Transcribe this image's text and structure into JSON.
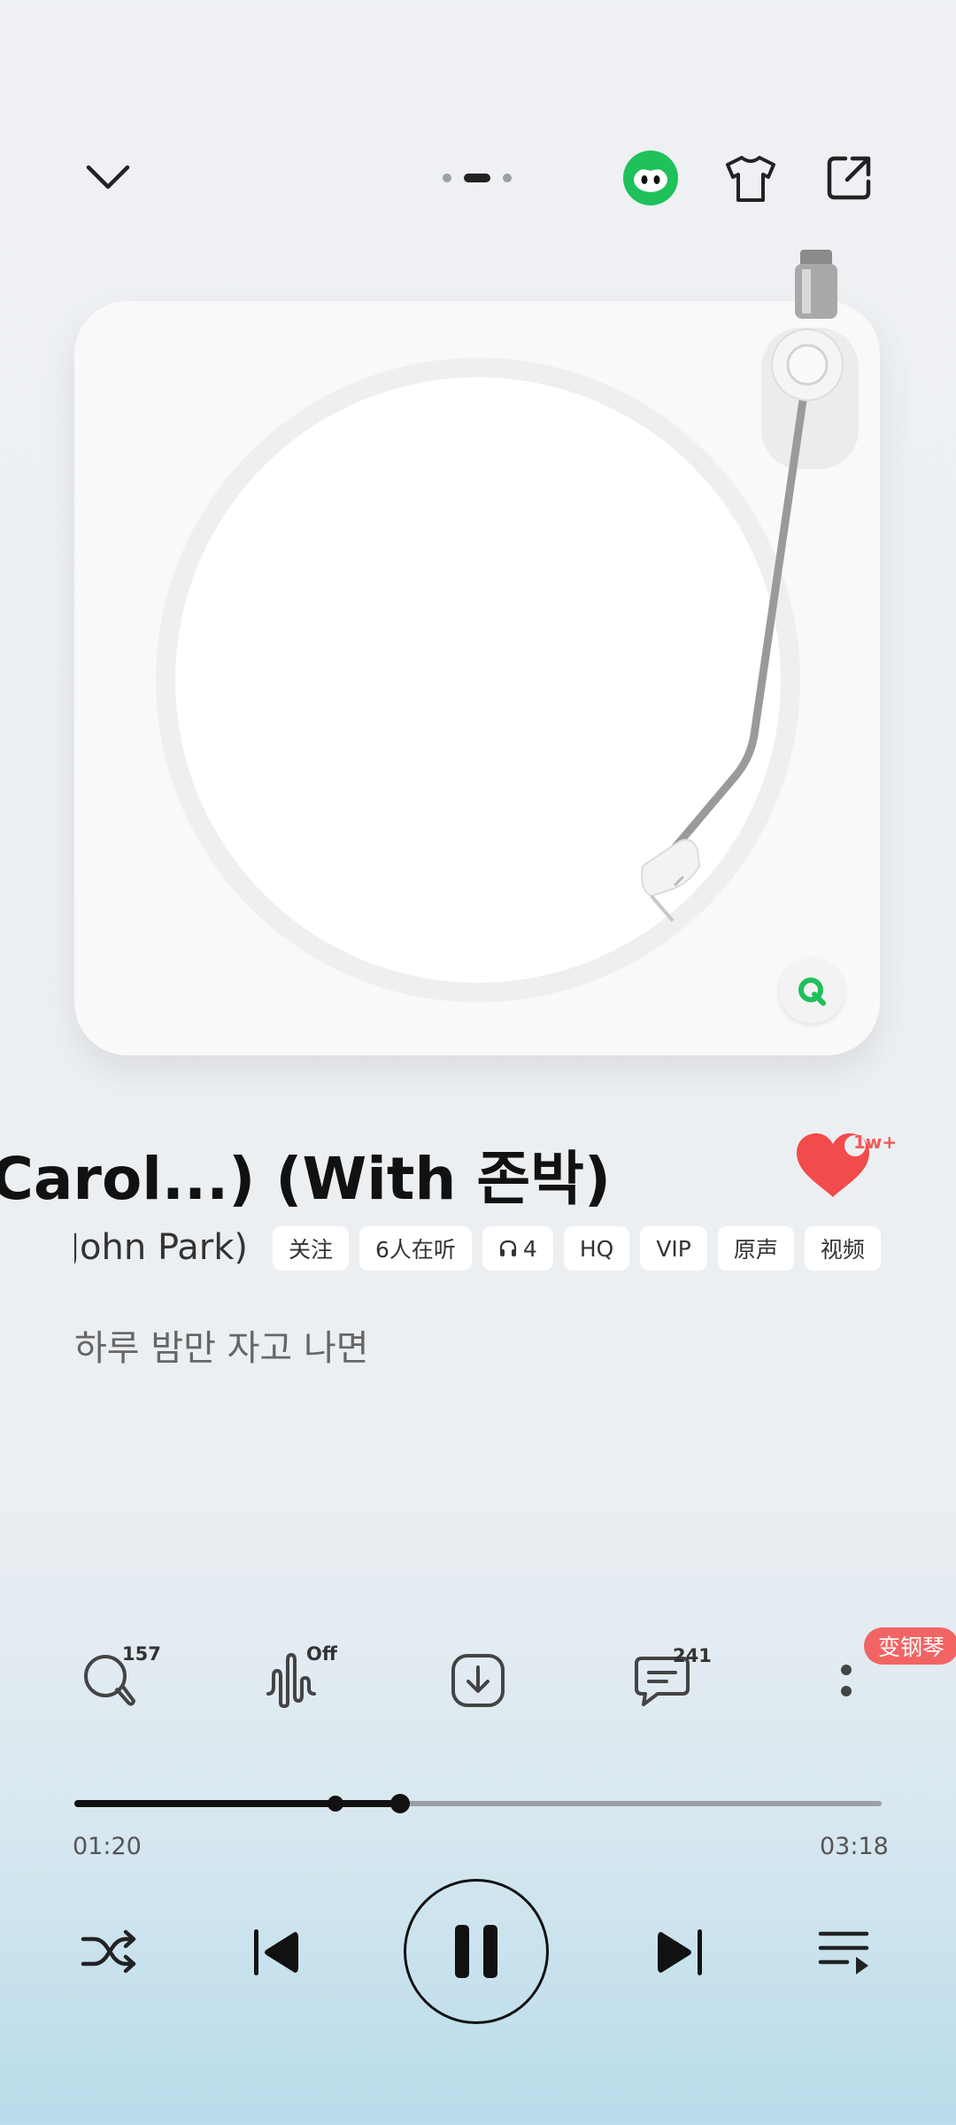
{
  "header": {
    "collapse_icon": "chevron-down-icon",
    "page_dots": 3,
    "active_dot": 1,
    "avatar_icon": "mascot-avatar-icon",
    "theme_icon": "tshirt-icon",
    "share_icon": "share-icon"
  },
  "player_art": {
    "type": "turntable",
    "brand_icon": "qq-music-q-icon"
  },
  "song": {
    "title": "Carol...) (With 존박)",
    "artist": "John Park)",
    "tags": [
      {
        "label": "关注",
        "icon": ""
      },
      {
        "label": "6人在听",
        "icon": ""
      },
      {
        "label": "4",
        "icon": "headphones-icon"
      },
      {
        "label": "HQ",
        "icon": ""
      },
      {
        "label": "VIP",
        "icon": ""
      },
      {
        "label": "原声",
        "icon": ""
      },
      {
        "label": "视频",
        "icon": ""
      }
    ],
    "lyric": "하루 밤만 자고 나면",
    "like_count": "1w+",
    "like_color": "#f24b4b"
  },
  "actions": {
    "search_count": "157",
    "effect_status": "Off",
    "download_icon": "download-icon",
    "comment_count": "241",
    "more_icon": "more-vertical-icon",
    "piano_label": "变钢琴",
    "piano_color": "#f26464"
  },
  "progress": {
    "elapsed": "01:20",
    "total": "03:18",
    "elapsed_fraction": 0.404,
    "marker_fraction": 0.324
  },
  "controls": {
    "shuffle_icon": "shuffle-icon",
    "prev_icon": "previous-icon",
    "play_state": "playing",
    "pause_icon": "pause-icon",
    "next_icon": "next-icon",
    "playlist_icon": "playlist-icon"
  }
}
